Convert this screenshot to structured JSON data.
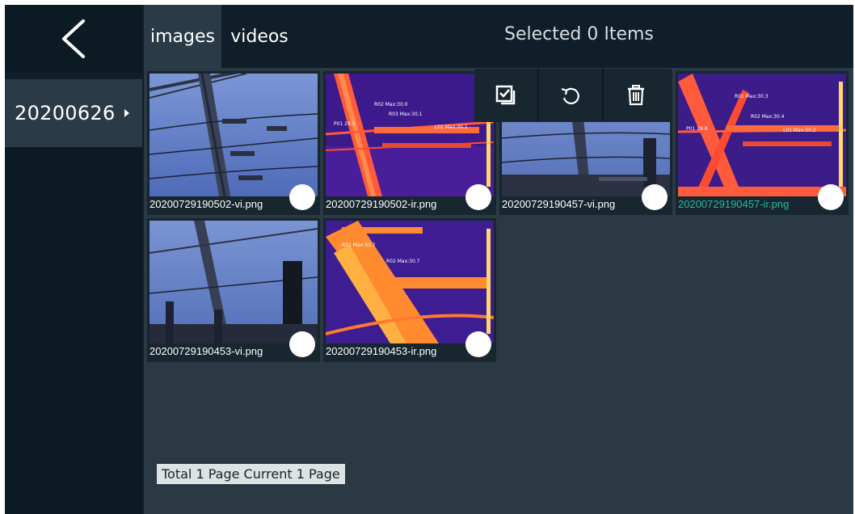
{
  "header": {
    "tabs": [
      {
        "label": "images",
        "active": true
      },
      {
        "label": "videos",
        "active": false
      }
    ],
    "selected_count": "Selected 0 Items"
  },
  "sidebar": {
    "folders": [
      {
        "label": "20200626"
      }
    ]
  },
  "toolbar": {
    "buttons": [
      "select-all-icon",
      "refresh-icon",
      "trash-icon"
    ]
  },
  "gallery": {
    "items": [
      {
        "filename": "20200729190502-vi.png",
        "kind": "visible"
      },
      {
        "filename": "20200729190502-ir.png",
        "kind": "infrared"
      },
      {
        "filename": "20200729190457-vi.png",
        "kind": "visible"
      },
      {
        "filename": "20200729190457-ir.png",
        "kind": "infrared",
        "highlighted": true
      },
      {
        "filename": "20200729190453-vi.png",
        "kind": "visible"
      },
      {
        "filename": "20200729190453-ir.png",
        "kind": "infrared"
      }
    ]
  },
  "thumb_overlays": {
    "ir1": {
      "r02": "R02 Max:30.0",
      "r03": "R03 Max:30.1",
      "p01": "P01 29.5",
      "l01": "L01 Max:30.1"
    },
    "ir2": {
      "r01": "R01 Max:30.3",
      "r02": "R02 Max:30.4",
      "p01": "P01 29.8",
      "l01": "L01 Max:30.2"
    },
    "ir3": {
      "r01": "R01 Max:33.7",
      "r02": "R02 Max:30.7"
    }
  },
  "pager": {
    "text": "Total 1 Page Current 1 Page"
  },
  "colors": {
    "background": "#0f1e28",
    "panel": "#2a3943",
    "active_tab": "#2a3b47",
    "accent": "#2cb89a"
  }
}
